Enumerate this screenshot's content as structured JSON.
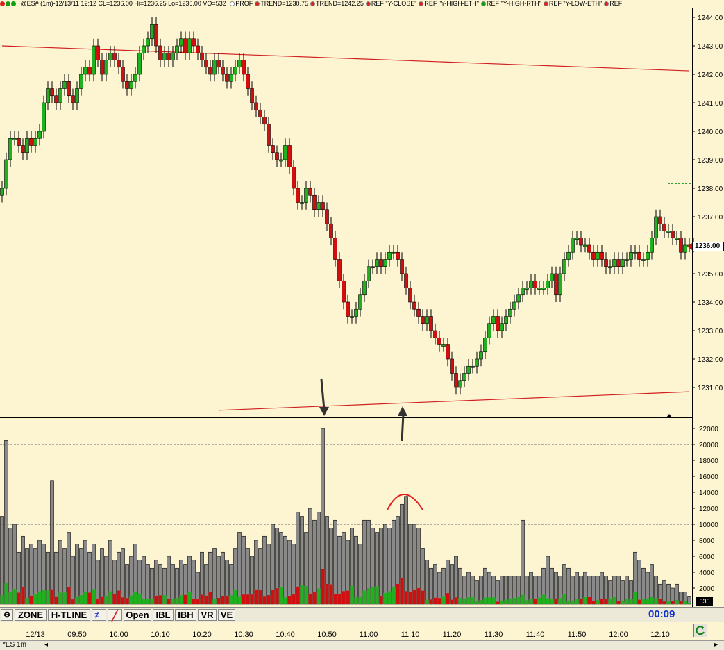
{
  "header": {
    "symbol_info": "@ES# (1m)-12/13/11 12:12 CL=1236.00 Hi=1236.25 Lo=1236.00 VO=532",
    "studies": [
      {
        "label": "PROF",
        "color": "#ffffff"
      },
      {
        "label": "TREND=1230.75",
        "color": "#e02020"
      },
      {
        "label": "TREND=1242.25",
        "color": "#e02020"
      },
      {
        "label": "REF \"Y-CLOSE\"",
        "color": "#e02020"
      },
      {
        "label": "REF \"Y-HIGH-ETH\"",
        "color": "#e02020"
      },
      {
        "label": "REF \"Y-HIGH-RTH\"",
        "color": "#10a010"
      },
      {
        "label": "REF \"Y-LOW-ETH\"",
        "color": "#e02020"
      },
      {
        "label": "REF",
        "color": "#e02020"
      }
    ]
  },
  "toolbar": {
    "buttons": [
      "ZONE",
      "H-TLINE",
      "Open",
      "IBL",
      "IBH",
      "VR",
      "VE"
    ],
    "clock": "00:09"
  },
  "tab": {
    "label": "*ES 1m"
  },
  "price_tag": "1236.00",
  "volume_tag": "535",
  "chart_data": [
    {
      "type": "candlestick",
      "title": "@ES# (1m)",
      "x_tick_labels": [
        "12/13",
        "09:50",
        "10:00",
        "10:10",
        "10:20",
        "10:30",
        "10:40",
        "10:50",
        "11:00",
        "11:10",
        "11:20",
        "11:30",
        "11:40",
        "11:50",
        "12:00",
        "12:10"
      ],
      "y_tick_labels": [
        "1231.00",
        "1232.00",
        "1233.00",
        "1234.00",
        "1235.00",
        "1236.00",
        "1237.00",
        "1238.00",
        "1239.00",
        "1240.00",
        "1241.00",
        "1242.00",
        "1243.00",
        "1244.00"
      ],
      "ylim": [
        1230.25,
        1244.25
      ],
      "up_color": "#20b020",
      "down_color": "#d01010",
      "last": 1236.0,
      "trendlines": [
        {
          "name": "TREND",
          "from_bar": 0,
          "from_price": 1243.0,
          "to_bar": 165,
          "to_price": 1242.12,
          "color": "#d02020"
        },
        {
          "name": "TREND",
          "from_bar": 52,
          "from_price": 1230.2,
          "to_bar": 165,
          "to_price": 1230.85,
          "color": "#d02020"
        }
      ],
      "closes": [
        1238.0,
        1239.0,
        1239.75,
        1239.75,
        1239.5,
        1239.25,
        1239.75,
        1239.5,
        1239.75,
        1240.0,
        1241.0,
        1241.5,
        1241.25,
        1241.0,
        1241.5,
        1241.75,
        1241.25,
        1241.0,
        1241.5,
        1242.0,
        1242.25,
        1242.0,
        1243.0,
        1242.5,
        1242.0,
        1242.5,
        1242.75,
        1242.5,
        1242.25,
        1241.75,
        1241.5,
        1241.75,
        1242.0,
        1242.75,
        1243.0,
        1243.25,
        1243.75,
        1243.0,
        1242.5,
        1242.75,
        1242.5,
        1242.75,
        1243.0,
        1243.25,
        1242.75,
        1243.25,
        1243.0,
        1242.75,
        1242.5,
        1242.25,
        1242.0,
        1242.5,
        1242.25,
        1242.0,
        1241.75,
        1242.0,
        1242.25,
        1242.5,
        1242.0,
        1241.5,
        1241.0,
        1240.75,
        1240.5,
        1240.25,
        1239.5,
        1239.25,
        1239.0,
        1239.0,
        1239.5,
        1238.75,
        1238.0,
        1237.5,
        1237.5,
        1238.0,
        1237.75,
        1237.25,
        1237.5,
        1237.25,
        1236.75,
        1236.25,
        1235.5,
        1234.75,
        1234.0,
        1233.5,
        1233.5,
        1233.75,
        1234.25,
        1234.75,
        1235.25,
        1235.25,
        1235.5,
        1235.25,
        1235.5,
        1235.75,
        1235.75,
        1235.5,
        1235.0,
        1234.5,
        1234.0,
        1233.75,
        1233.5,
        1233.25,
        1233.5,
        1233.0,
        1232.75,
        1232.5,
        1232.5,
        1232.0,
        1231.5,
        1231.0,
        1231.25,
        1231.5,
        1231.75,
        1231.75,
        1232.0,
        1232.25,
        1232.75,
        1233.25,
        1233.5,
        1233.0,
        1233.25,
        1233.5,
        1233.75,
        1234.0,
        1234.25,
        1234.5,
        1234.5,
        1234.75,
        1234.5,
        1234.5,
        1234.5,
        1234.75,
        1235.0,
        1234.25,
        1235.0,
        1235.5,
        1235.75,
        1236.25,
        1236.25,
        1236.0,
        1236.0,
        1235.75,
        1235.5,
        1235.75,
        1235.5,
        1235.25,
        1235.25,
        1235.5,
        1235.25,
        1235.5,
        1235.5,
        1235.75,
        1235.75,
        1235.5,
        1235.5,
        1235.75,
        1236.25,
        1237.0,
        1236.75,
        1236.5,
        1236.5,
        1236.25,
        1236.25,
        1235.75,
        1236.0,
        1236.0,
        1236.0
      ]
    },
    {
      "type": "bar",
      "title": "Volume",
      "y_tick_labels": [
        "2000",
        "4000",
        "6000",
        "8000",
        "10000",
        "12000",
        "14000",
        "16000",
        "18000",
        "20000",
        "22000"
      ],
      "ylim": [
        0,
        23000
      ],
      "reference_lines": [
        10000,
        20000
      ],
      "peak_marker_bar": 97,
      "arrows": [
        {
          "bar": 77,
          "direction": "down"
        },
        {
          "bar": 96,
          "direction": "up"
        }
      ],
      "values": [
        11000,
        20500,
        9500,
        10000,
        6500,
        8500,
        7000,
        7500,
        7000,
        8000,
        7500,
        6500,
        15500,
        6500,
        8000,
        7000,
        9000,
        6000,
        7500,
        7000,
        8000,
        6500,
        7500,
        5500,
        7000,
        6000,
        8000,
        5500,
        6500,
        7000,
        5000,
        6000,
        7500,
        5500,
        6000,
        5000,
        4500,
        5500,
        5000,
        4500,
        6000,
        5000,
        4500,
        5500,
        5000,
        6000,
        5500,
        4000,
        6500,
        5000,
        6500,
        7000,
        6000,
        6500,
        5500,
        5000,
        7000,
        9000,
        8500,
        7000,
        6000,
        8000,
        7000,
        8500,
        7500,
        10000,
        9500,
        9000,
        8500,
        8000,
        7500,
        11500,
        11000,
        9000,
        12000,
        10500,
        11500,
        22000,
        11000,
        9500,
        10500,
        8500,
        9000,
        8000,
        9500,
        8500,
        7500,
        10500,
        10500,
        9500,
        9000,
        9500,
        10000,
        9500,
        10500,
        11000,
        12500,
        13500,
        10000,
        10000,
        9500,
        7000,
        5500,
        4500,
        5000,
        4000,
        4500,
        5500,
        5000,
        6000,
        4500,
        3500,
        4000,
        3500,
        3000,
        3500,
        4500,
        4000,
        3500,
        3000,
        3500,
        3500,
        3500,
        3500,
        3500,
        10500,
        3500,
        4000,
        3500,
        3500,
        4500,
        6000,
        4500,
        4000,
        3500,
        5000,
        4500,
        3500,
        4000,
        3500,
        4000,
        3500,
        3500,
        3500,
        4000,
        3500,
        3000,
        3500,
        3500,
        3000,
        3500,
        3000,
        6500,
        5500,
        4500,
        4000,
        5000,
        3500,
        2500,
        3000,
        2500,
        2000,
        2500,
        1500,
        1500,
        1000
      ]
    }
  ]
}
